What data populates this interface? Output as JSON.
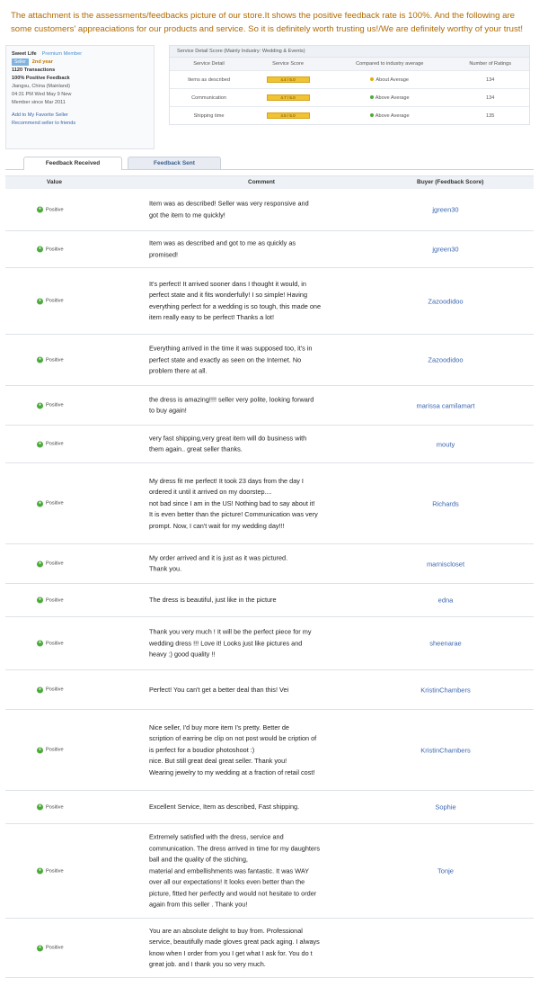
{
  "intro_text": "The attachment is the assessments/feedbacks picture of our store.It shows the positive feedback rate is 100%. And the following are some customers' appreaciations for our products and service. So it is definitely worth trusting us!/We are definitely worthy of your trust!",
  "seller": {
    "name": "Sweet Life",
    "membership": "Premium Member",
    "badge": "Seller",
    "years": "2nd year",
    "transactions": "1120 Transactions",
    "feedback": "100% Positive Feedback",
    "location": "Jiangsu, China (Mainland)",
    "local_time": "04:31 PM Wed May 9 New",
    "member_since": "Member since Mar 2011",
    "link_favorite": "Add to My Favorite Seller",
    "link_recommend": "Recommend seller to friends"
  },
  "dsr": {
    "title": "Service Detail Score (Mainly Industry: Wedding & Events)",
    "columns": [
      "Service Detail",
      "Service Score",
      "Compared to industry average",
      "Number of Ratings"
    ],
    "rows": [
      {
        "detail": "Items as described",
        "score": "4.4 / 5.0",
        "compare": "About Average",
        "ratings": "134"
      },
      {
        "detail": "Communication",
        "score": "4.7 / 5.0",
        "compare": "Above Average",
        "ratings": "134"
      },
      {
        "detail": "Shipping time",
        "score": "4.5 / 5.0",
        "compare": "Above Average",
        "ratings": "135"
      }
    ]
  },
  "tabs": {
    "received": "Feedback Received",
    "sent": "Feedback Sent"
  },
  "columns": {
    "value": "Value",
    "comment": "Comment",
    "buyer": "Buyer (Feedback Score)"
  },
  "colors": {
    "positive": "#4caa3a",
    "link": "#3b66b0",
    "intro": "#b06a00",
    "star": "#f1c232"
  },
  "feedback": [
    {
      "value": "Positive",
      "comment": "Item was as described! Seller was very responsive and\ngot the item to me quickly!",
      "buyer": "jgreen30"
    },
    {
      "value": "Positive",
      "comment": "Item was as described and got to me as quickly  as\npromised!",
      "buyer": "jgreen30"
    },
    {
      "value": "Positive",
      "comment": "It's perfect! It arrived sooner dans I thought it would, in\nperfect state and it fits wonderfully! I so simple! Having\neverything perfect for a wedding is so tough, this made one\nitem really easy to  be perfect! Thanks a lot!",
      "buyer": "Zazoodidoo"
    },
    {
      "value": "Positive",
      "comment": "Everything arrived in the time it was supposed too, it's in\nperfect state and exactly as seen on the Internet. No\nproblem there at all.",
      "buyer": "Zazoodidoo"
    },
    {
      "value": "Positive",
      "comment": "the dress is amazing!!!! seller very polite, looking  forward\nto buy again!",
      "buyer": "marissa camilamart"
    },
    {
      "value": "Positive",
      "comment": "very fast shipping,very great item will do business with\nthem again.. great seller thanks.",
      "buyer": "mouty"
    },
    {
      "value": "Positive",
      "comment": "My dress fit me perfect! It took 23 days from the day I\nordered it until it arrived on my doorstep....\nnot bad since I am in the US! Nothing bad to say   about it!\nIt is even better than the picture! Communication was very\nprompt. Now, I can't wait for  my wedding day!!!",
      "buyer": "Richards"
    },
    {
      "value": "Positive",
      "comment": "My order arrived and it is just as it was pictured.\nThank you.",
      "buyer": "marniscloset"
    },
    {
      "value": "Positive",
      "comment": "The dress is beautiful, just like in the picture",
      "buyer": "edna"
    },
    {
      "value": "Positive",
      "comment": "Thank you very much ! It will be the perfect piece for my\nwedding dress !!! Love it! Looks just like pictures and\nheavy :) good quality !!",
      "buyer": "sheenarae"
    },
    {
      "value": "Positive",
      "comment": "Perfect! You can't get a better deal than this! Vei",
      "buyer": "KristinChambers"
    },
    {
      "value": "Positive",
      "comment": "Nice seller, I'd buy more item I's pretty. Better de\nscription of earring be clip on not post would be   cription of\nis perfect for a boudior photoshoot :)\nnice. But still great deal great seller. Thank you!\nWearing jewelry to my wedding at a fraction of retail cost!",
      "buyer": "KristinChambers"
    },
    {
      "value": "Positive",
      "comment": "Excellent Service, Item as described, Fast shipping.",
      "buyer": "Sophie"
    },
    {
      "value": "Positive",
      "comment": "Extremely satisfied with the dress, service and\ncommunication. The dress arrived in time for my daughters\nball and the quality of the stiching,\nmaterial and embellishments was fantastic. It was WAY\nover all our expectations! It looks even better than the\npicture, fitted her perfectly and  would not hesitate to order\nagain from this seller . Thank you!",
      "buyer": "Tonje"
    },
    {
      "value": "Positive",
      "comment": "You are an absolute delight to buy from. Professional\nservice, beautifully made gloves great pack  aging. I always\nknow when I order from you I get  what I ask for. You do t\ngreat job. and I thank you so very much.",
      "buyer": ""
    }
  ]
}
